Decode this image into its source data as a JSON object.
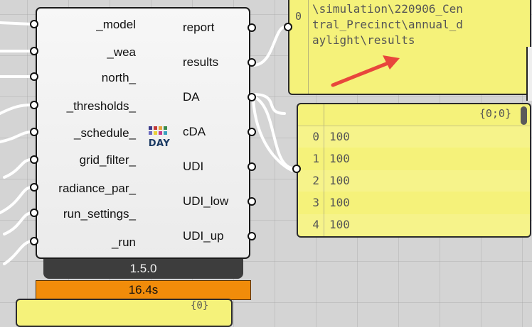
{
  "component": {
    "inputs": [
      "_model",
      "_wea",
      "north_",
      "_thresholds_",
      "_schedule_",
      "grid_filter_",
      "radiance_par_",
      "run_settings_",
      "_run"
    ],
    "outputs": [
      "report",
      "results",
      "DA",
      "cDA",
      "UDI",
      "UDI_low",
      "UDI_up"
    ],
    "icon_word": "DAY",
    "version": "1.5.0",
    "timing": "16.4s"
  },
  "results_panel": {
    "index": "0",
    "path_lines": [
      "\\simulation\\220906_Cen",
      "tral_Precinct\\annual_d",
      "aylight\\results"
    ]
  },
  "da_panel": {
    "header": "{0;0}",
    "rows": [
      {
        "index": "0",
        "value": "100"
      },
      {
        "index": "1",
        "value": "100"
      },
      {
        "index": "2",
        "value": "100"
      },
      {
        "index": "3",
        "value": "100"
      },
      {
        "index": "4",
        "value": "100"
      }
    ]
  },
  "bottom_panel": {
    "header": "{0}"
  },
  "colors": {
    "panel": "#f5f27a",
    "timing": "#f18c0a",
    "version_bar": "#3d3d3d",
    "arrow": "#e8463c"
  }
}
